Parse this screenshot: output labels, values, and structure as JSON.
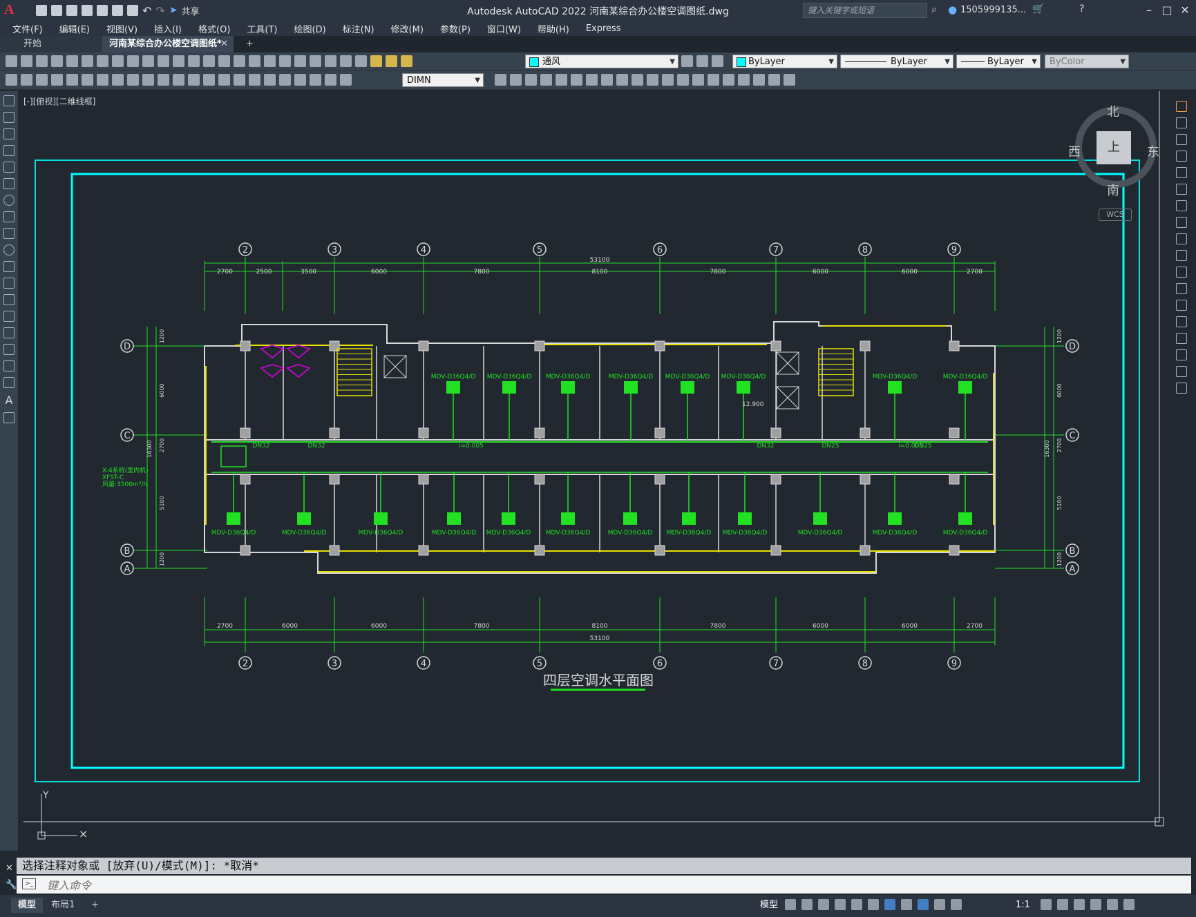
{
  "app": {
    "logo": "A",
    "title": "Autodesk AutoCAD 2022    河南某综合办公楼空调图纸.dwg",
    "share_label": "共享",
    "search_placeholder": "键入关键字或短语",
    "user": "1505999135..."
  },
  "menu": [
    "文件(F)",
    "编辑(E)",
    "视图(V)",
    "插入(I)",
    "格式(O)",
    "工具(T)",
    "绘图(D)",
    "标注(N)",
    "修改(M)",
    "参数(P)",
    "窗口(W)",
    "帮助(H)",
    "Express"
  ],
  "tabs": {
    "start": "开始",
    "active": "河南某综合办公楼空调图纸*",
    "add": "+"
  },
  "toolbar": {
    "layer": "通风",
    "color": "ByLayer",
    "linetype": "ByLayer",
    "lineweight": "ByLayer",
    "plotstyle": "ByColor",
    "dimstyle": "DIMN"
  },
  "viewport": {
    "label": "[-][俯视][二维线框]",
    "compass_n": "北",
    "compass_s": "南",
    "compass_e": "东",
    "compass_w": "西",
    "cube_face": "上",
    "wcs": "WCS"
  },
  "drawing": {
    "title": "四层空调水平面图",
    "axes_top": [
      "2",
      "3",
      "4",
      "5",
      "6",
      "7",
      "8",
      "9"
    ],
    "axes_left": [
      "D",
      "C",
      "B",
      "A"
    ],
    "dims_top": [
      "2700",
      "2500",
      "3500",
      "6000",
      "7800",
      "8100",
      "7800",
      "6000",
      "6000",
      "2700"
    ],
    "dims_bottom": [
      "2700",
      "6000",
      "6000",
      "7800",
      "8100",
      "7800",
      "6000",
      "6000",
      "2700"
    ],
    "total_dim": "53100",
    "dims_side": [
      "1200",
      "6000",
      "2700",
      "5100",
      "1200"
    ],
    "side_total": "16300",
    "unit_top": [
      "MDV-D36Q4/D",
      "MDV-D36Q4/D",
      "MDV-D36Q4/D",
      "MDV-D36Q4/D",
      "MDV-D36Q4/D",
      "MDV-D36Q4/D",
      "MDV-D36Q4/D",
      "MDV-D36Q4/D"
    ],
    "unit_bottom": [
      "MDV-D36Q4/D",
      "MDV-D36Q4/D",
      "MDV-D36Q4/D",
      "MDV-D36Q4/D",
      "MDV-D36Q4/D",
      "MDV-D36Q4/D",
      "MDV-D36Q4/D",
      "MDV-D36Q4/D",
      "MDV-D36Q4/D",
      "MDV-D36Q4/D",
      "MDV-D36Q4/D",
      "MDV-D36Q4/D"
    ],
    "pipe_labels": [
      "DN32",
      "DN32",
      "i=0.005",
      "DN32",
      "DN25",
      "i=0.005",
      "DN25"
    ],
    "fan_note_1": "X-4系统(室内机)",
    "fan_note_2": "XFST-C",
    "fan_note_3": "风量:3500m³/h",
    "elev": "12.900"
  },
  "command": {
    "history": "选择注释对象或 [放弃(U)/模式(M)]: *取消*",
    "placeholder": "键入命令"
  },
  "status": {
    "model_tab": "模型",
    "layout_tab": "布局1",
    "add": "+",
    "model_btn": "模型",
    "scale": "1:1"
  }
}
